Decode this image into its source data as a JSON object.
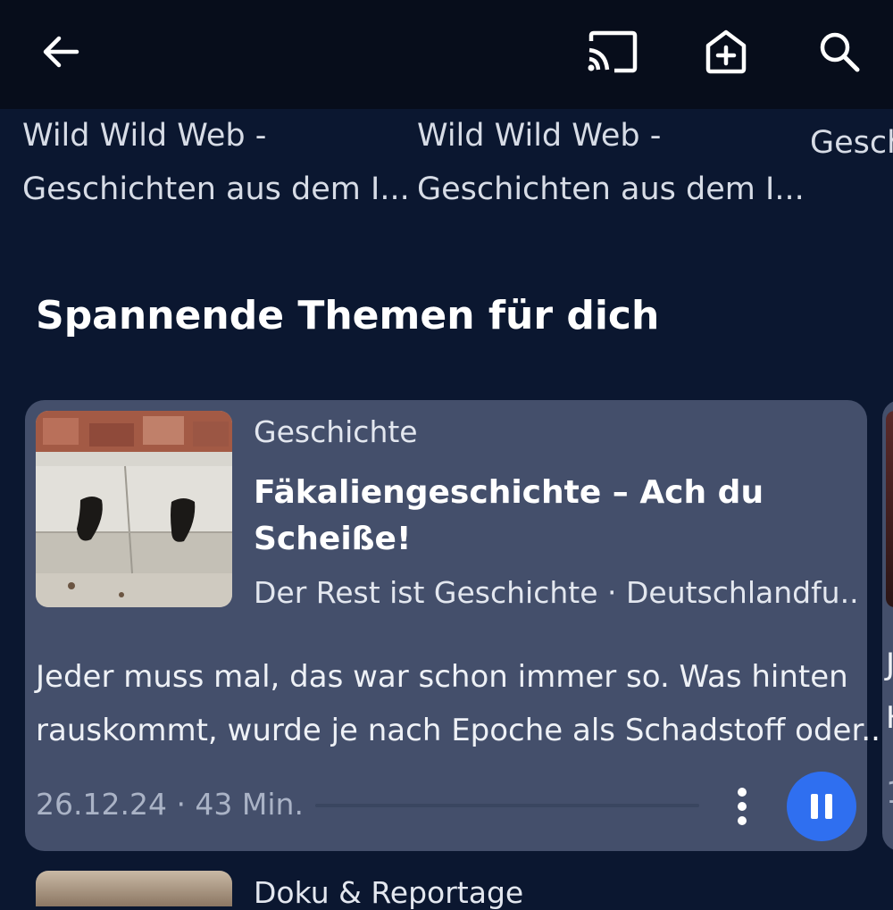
{
  "prev_row": {
    "items": [
      {
        "line1": "Wild Wild Web -",
        "line2": "Geschichten aus dem I..."
      },
      {
        "line1": "Wild Wild Web -",
        "line2": "Geschichten aus dem I..."
      },
      {
        "line1": "Gesch",
        "line2": ""
      }
    ]
  },
  "section": {
    "title": "Spannende Themen für dich"
  },
  "card": {
    "category": "Geschichte",
    "title_line1": "Fäkaliengeschichte – Ach du",
    "title_line2": "Scheiße!",
    "podcast": "Der Rest ist Geschichte · Deutschlandfu...",
    "desc_line1": "Jeder muss mal, das war schon immer so. Was hinten",
    "desc_line2": "rauskommt, wurde je nach Epoche als Schadstoff oder...",
    "meta": "26.12.24 · 43 Min.",
    "progress": 0.0
  },
  "peek": {
    "line1": "J",
    "line2": "H",
    "line3": "1"
  },
  "next": {
    "category": "Doku & Reportage"
  },
  "colors": {
    "accent": "#2f6ff0",
    "card": "#444f6b",
    "background": "#0b1730",
    "topbar": "#070d1b"
  },
  "icons": [
    "arrow-left-icon",
    "cast-icon",
    "add-to-queue-icon",
    "search-icon",
    "more-vertical-icon",
    "pause-icon"
  ]
}
